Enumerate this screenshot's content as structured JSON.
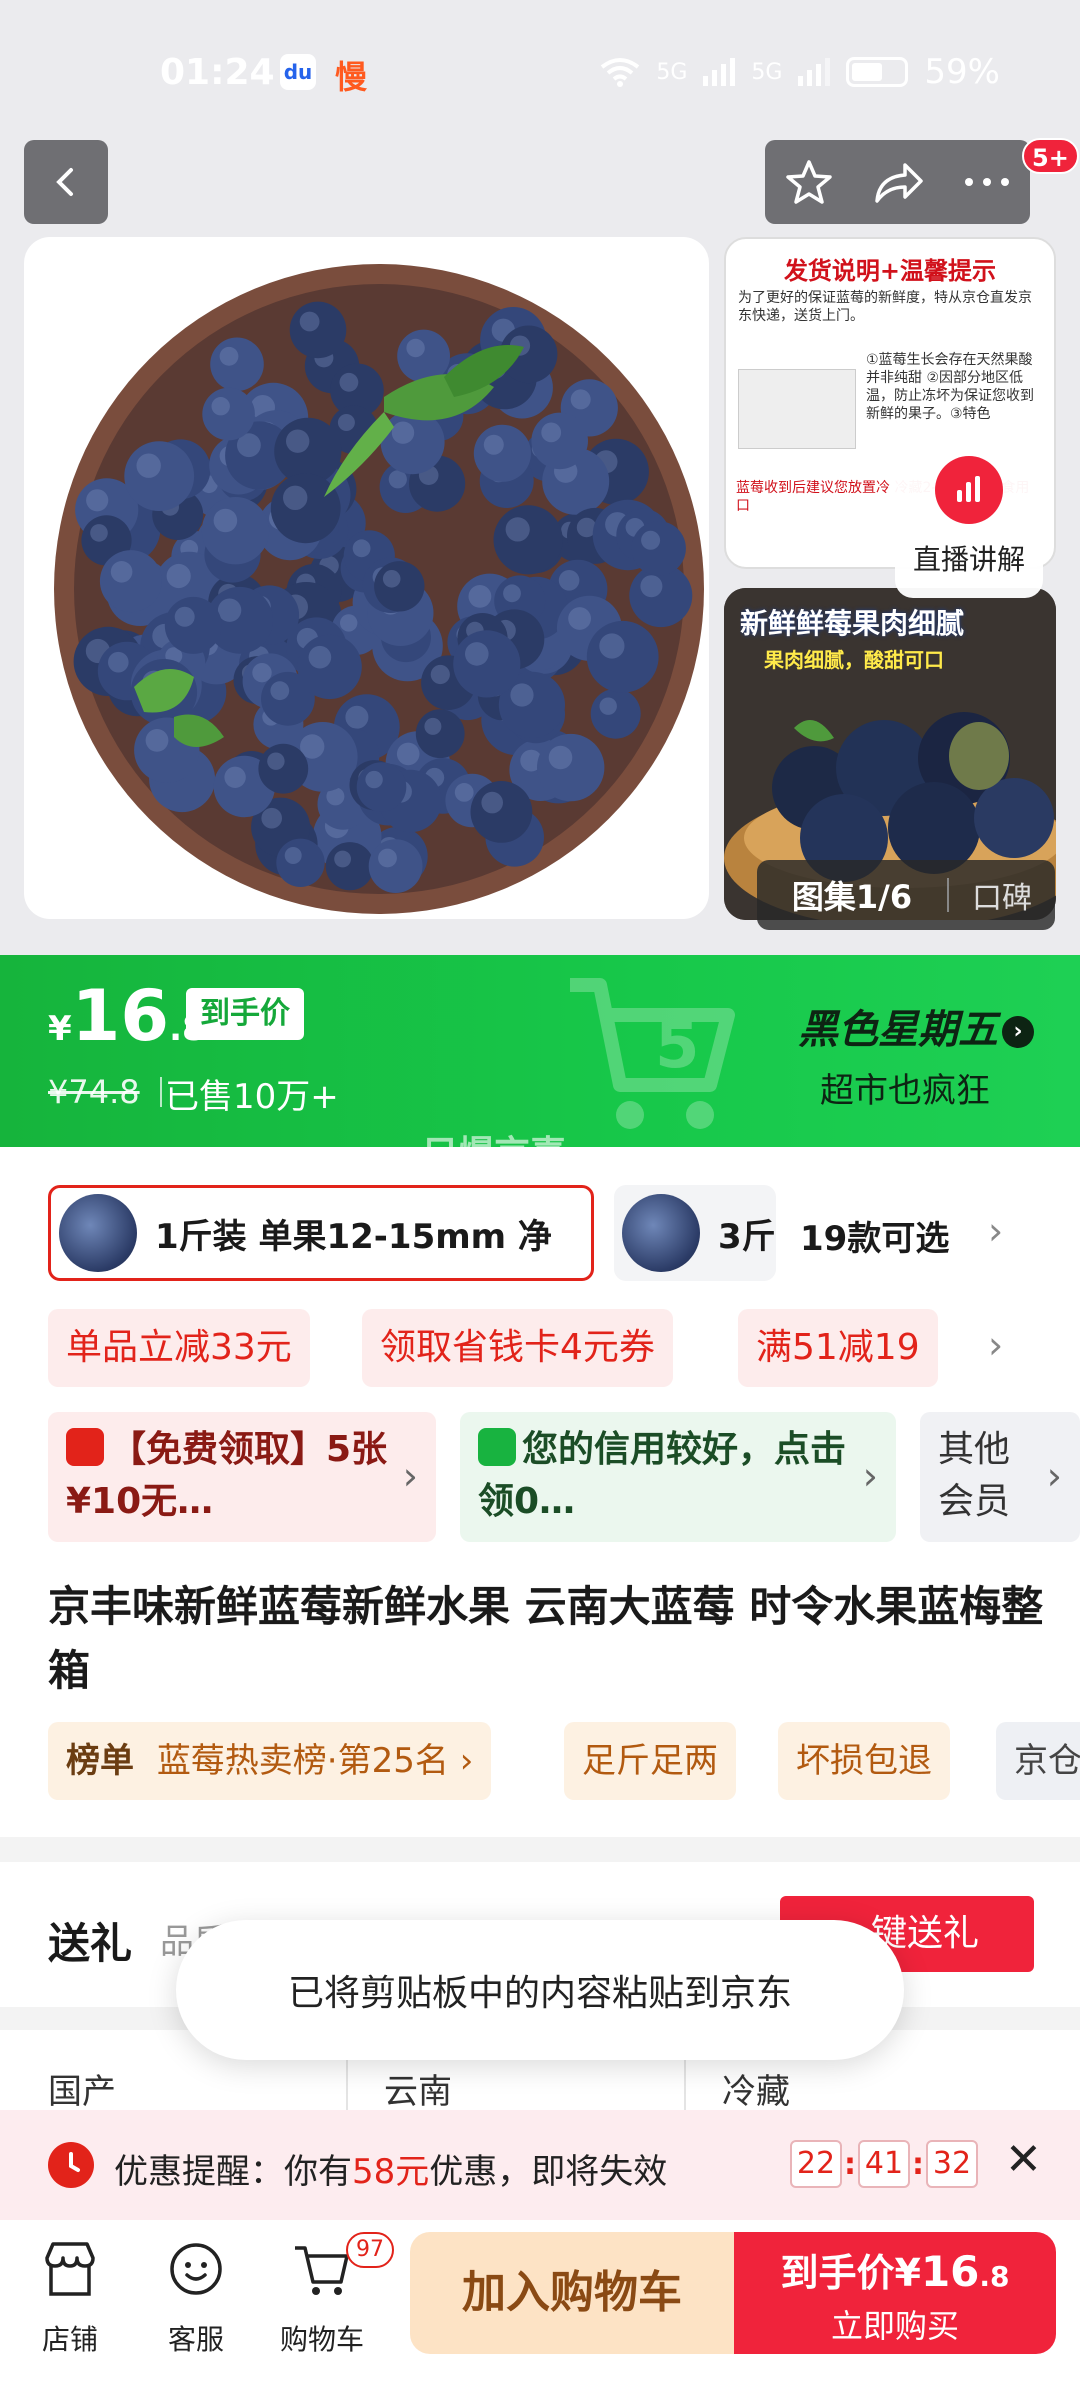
{
  "status_bar": {
    "time": "01:24",
    "app_icon_1": "baidu-icon",
    "app_icon_2_text": "慢",
    "battery": "59%",
    "net1": "5G",
    "net2": "5G"
  },
  "header": {
    "notifications": "5+"
  },
  "gallery": {
    "thumb1": {
      "title": "发货说明+温馨提示",
      "text": "为了更好的保证蓝莓的新鲜度，特从京仓直发京东快递，送货上门。",
      "list": "①蓝莓生长会存在天然果酸并非纯甜 ②因部分地区低温，防止冻坏为保证您收到新鲜的果子。③特色",
      "bottom": "蓝莓收到后建议您放置冷 冷藏2-3小时后再食用 口"
    },
    "thumb2": {
      "title": "新鲜鲜莓果肉细腻",
      "sub": "果肉细腻，酸甜可口"
    },
    "live_label": "直播讲解",
    "album_label": "图集1/6",
    "album_sub": "口碑"
  },
  "price_banner": {
    "yen": "¥",
    "price_int": "16",
    "price_dec": ".8",
    "price_tag": "到手价",
    "original_price": "¥74.8",
    "sold": "已售10万+",
    "promo_title": "黑色星期五",
    "promo_sub": "超市也疯狂",
    "watermark": "只爆京喜"
  },
  "variants": {
    "selected": "1斤装 单果12-15mm 净",
    "other": "3斤",
    "more": "19款可选"
  },
  "coupons": [
    "单品立减33元",
    "领取省钱卡4元券",
    "满51减19"
  ],
  "promo_cards": [
    {
      "text": "【免费领取】5张¥10无…"
    },
    {
      "text": "您的信用较好，点击领0…"
    },
    {
      "text": "其他会员"
    }
  ],
  "product_title": "京丰味新鲜蓝莓新鲜水果 云南大蓝莓 时令水果蓝梅整箱",
  "tags": {
    "rank_label": "榜单",
    "rank_value": "蓝莓热卖榜·第25名",
    "tag2": "足斤足两",
    "tag3": "坏损包退",
    "tag4": "京仓"
  },
  "gift": {
    "title": "送礼",
    "sub": "品质好礼 定制贺卡",
    "button": "一键送礼"
  },
  "specs": [
    "国产",
    "云南",
    "冷藏"
  ],
  "toast": "已将剪贴板中的内容粘贴到京东",
  "reminder": {
    "prefix": "优惠提醒：你有",
    "amount": "58元",
    "suffix": "优惠，即将失效",
    "hh": "22",
    "mm": "41",
    "ss": "32"
  },
  "bottom_nav": {
    "shop": "店铺",
    "service": "客服",
    "cart": "购物车",
    "cart_count": "97",
    "add_cart": "加入购物车",
    "buy_price_prefix": "到手价",
    "buy_price_yen": "¥",
    "buy_price_int": "16",
    "buy_price_dec": ".8",
    "buy_label": "立即购买"
  },
  "colors": {
    "brand_red": "#e2231a",
    "promo_green": "#16b43c",
    "cart_orange": "#fde3c5"
  }
}
